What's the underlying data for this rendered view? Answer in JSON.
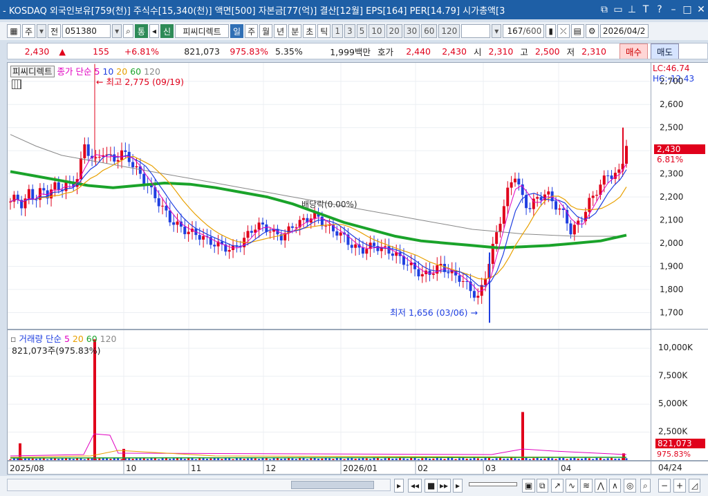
{
  "titlebar": {
    "text": "- KOSDAQ 외국인보유[759(천)] 주식수[15,340(천)] 액면[500] 자본금[77(억)] 결산[12월] EPS[164] PER[14.79] 시가총액[3",
    "icons": [
      "restore-icon",
      "tile-icon",
      "pin-icon",
      "text-icon",
      "help-icon",
      "minimize-icon",
      "maximize-icon",
      "close-icon"
    ]
  },
  "toolbar": {
    "market_type": "주",
    "all_label": "전",
    "code": "051380",
    "tong_label": "통",
    "sin_label": "신",
    "stock_name": "피씨디렉트",
    "periods": [
      "일",
      "주",
      "월",
      "년",
      "분",
      "초",
      "틱"
    ],
    "intervals": [
      "1",
      "3",
      "5",
      "10",
      "20",
      "30",
      "60",
      "120"
    ],
    "count": "167",
    "count_total": "/600",
    "date": "2026/04/2"
  },
  "infobar": {
    "price": "2,430",
    "change_arrow": "▲",
    "change": "155",
    "change_pct": "+6.81%",
    "volume": "821,073",
    "volume_ratio": "975.83%",
    "turnover": "5.35%",
    "amount": "1,999백만",
    "hoga_label": "호가",
    "ask": "2,440",
    "bid": "2,430",
    "open_label": "시",
    "open": "2,310",
    "high_label": "고",
    "high": "2,500",
    "low_label": "저",
    "low": "2,310",
    "buy_label": "매수",
    "sell_label": "매도"
  },
  "price_panel": {
    "stock_chip": "피씨디렉트",
    "legend_prefix": "종가 단순",
    "ma_labels": [
      "5",
      "10",
      "20",
      "60",
      "120"
    ],
    "lc_label": "LC:46.74",
    "hc_label": "HC:-12.43",
    "max_annotation": "최고 2,775 (09/19)",
    "min_annotation": "최저 1,656 (03/06)",
    "dividend_annotation": "배당락(0.00%)",
    "current_price_tag": "2,430",
    "current_pct_tag": "6.81%"
  },
  "volume_panel": {
    "legend_prefix": "거래량 단순",
    "ma_labels": [
      "5",
      "20",
      "60",
      "120"
    ],
    "current_text": "821,073주(975.83%)",
    "current_tag": "821,073",
    "current_pct_tag": "975.83%"
  },
  "colors": {
    "up": "#e0001b",
    "down": "#1f3fe0",
    "ma5": "#e000c0",
    "ma10": "#1f3fe0",
    "ma20": "#e8a000",
    "ma60": "#1aa32a",
    "ma120": "#888888"
  },
  "chart_data": {
    "type": "candlestick",
    "y_ticks": [
      1700,
      1800,
      1900,
      2000,
      2100,
      2200,
      2300,
      2400,
      2500,
      2600,
      2700
    ],
    "y_tick_labels": [
      "1,700",
      "1,800",
      "1,900",
      "2,000",
      "2,100",
      "2,200",
      "2,300",
      "2,400",
      "2,500",
      "2,600",
      "2,700"
    ],
    "ylim": [
      1600,
      2750
    ],
    "x_labels": [
      "2025/08",
      "10",
      "11",
      "12",
      "2026/01",
      "02",
      "03",
      "04"
    ],
    "x_end_label": "04/24",
    "volume_ticks": [
      2500,
      5000,
      7500,
      10000
    ],
    "volume_tick_labels": [
      "2,500K",
      "5,000K",
      "7,500K",
      "10,000K"
    ],
    "volume_ylim": [
      0,
      11000
    ],
    "ma60_points": [
      2310,
      2290,
      2270,
      2250,
      2240,
      2250,
      2260,
      2255,
      2240,
      2220,
      2200,
      2170,
      2130,
      2090,
      2060,
      2030,
      2010,
      2000,
      1990,
      1980,
      1985,
      1990,
      2000,
      2010,
      2035
    ],
    "ma120_points": [
      2470,
      2420,
      2380,
      2360,
      2340,
      2320,
      2300,
      2280,
      2260,
      2240,
      2220,
      2200,
      2180,
      2160,
      2140,
      2120,
      2100,
      2080,
      2060,
      2050,
      2040,
      2035,
      2030,
      2030,
      2030
    ],
    "max": 2775,
    "min": 1656,
    "last": 2430
  }
}
